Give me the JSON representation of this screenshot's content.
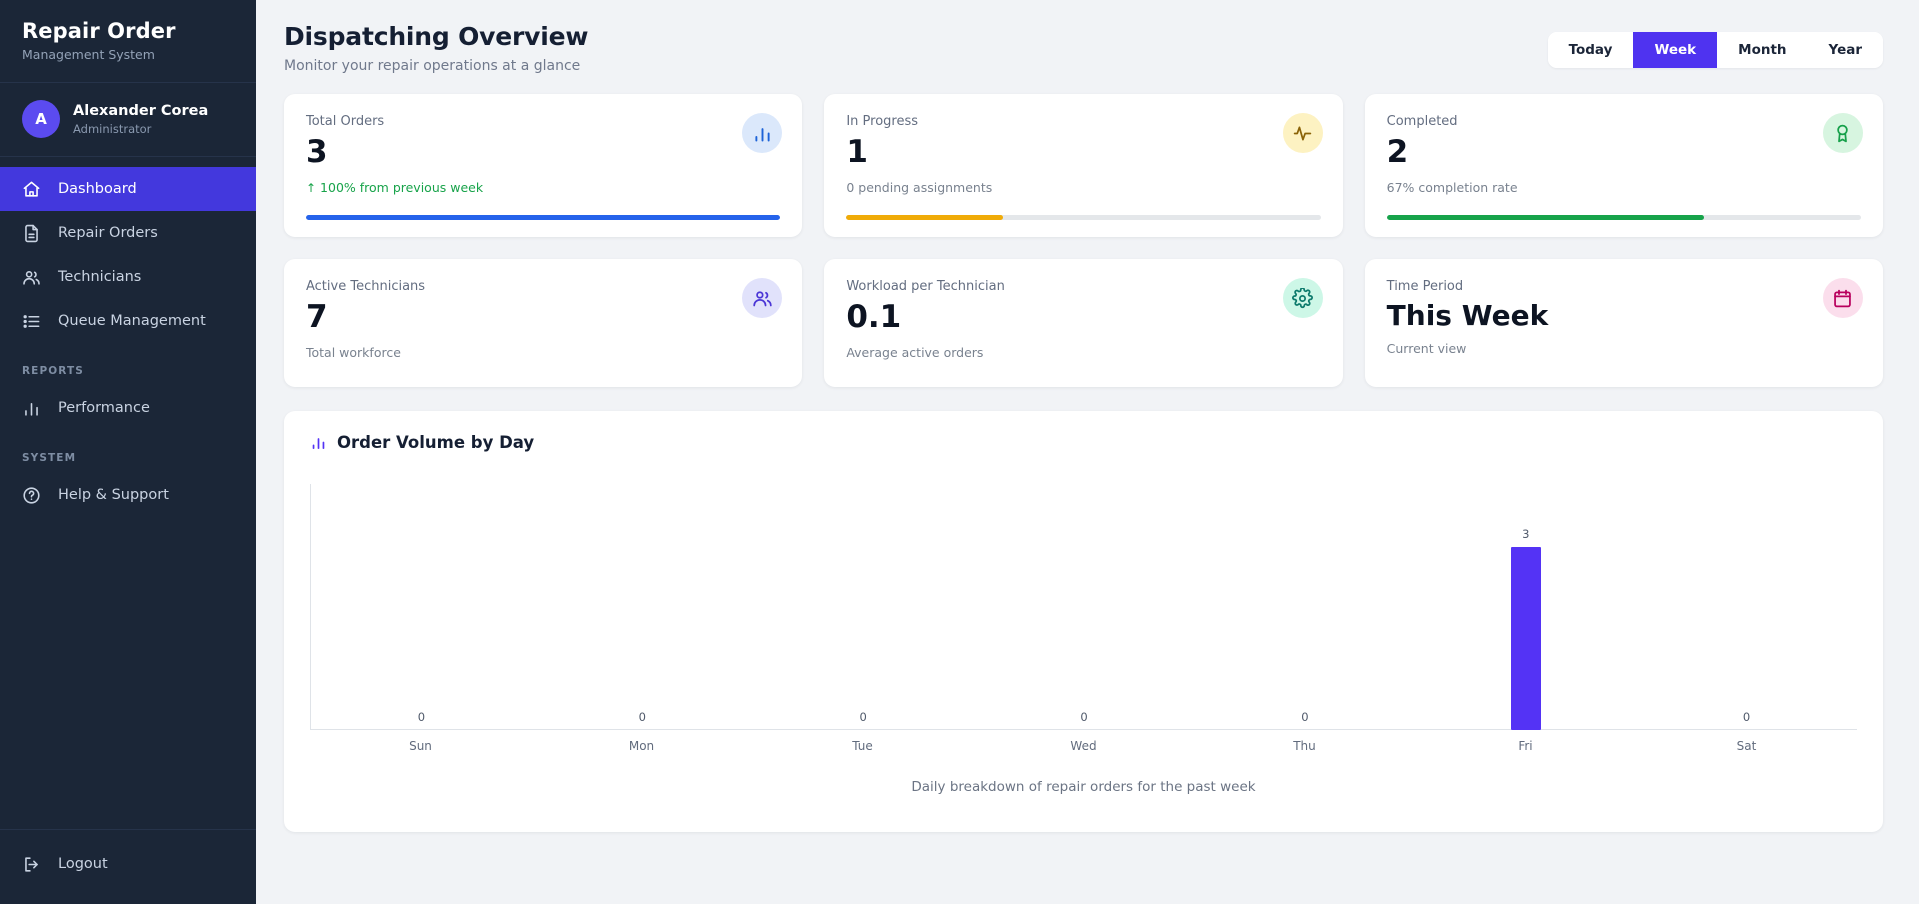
{
  "sidebar": {
    "brand_title": "Repair Order",
    "brand_subtitle": "Management System",
    "user": {
      "initial": "A",
      "name": "Alexander Corea",
      "role": "Administrator"
    },
    "items": [
      {
        "label": "Dashboard",
        "icon": "home-icon",
        "active": true
      },
      {
        "label": "Repair Orders",
        "icon": "document-icon",
        "active": false
      },
      {
        "label": "Technicians",
        "icon": "users-icon",
        "active": false
      },
      {
        "label": "Queue Management",
        "icon": "list-icon",
        "active": false
      }
    ],
    "reports_section": "REPORTS",
    "reports_items": [
      {
        "label": "Performance",
        "icon": "bar-chart-icon",
        "active": false
      }
    ],
    "system_section": "SYSTEM",
    "system_items": [
      {
        "label": "Help & Support",
        "icon": "help-circle-icon",
        "active": false
      }
    ],
    "logout_label": "Logout",
    "logout_icon": "logout-icon",
    "active_color": "#4338dd",
    "background_color": "#1b2637"
  },
  "header": {
    "title": "Dispatching Overview",
    "subtitle": "Monitor your repair operations at a glance",
    "range_options": [
      {
        "label": "Today",
        "active": false
      },
      {
        "label": "Week",
        "active": true
      },
      {
        "label": "Month",
        "active": false
      },
      {
        "label": "Year",
        "active": false
      }
    ],
    "active_color": "#4f33f0"
  },
  "cards": [
    {
      "label": "Total Orders",
      "value": "3",
      "note": "100% from previous week",
      "note_arrow": "↑",
      "note_trend": "up",
      "icon": "bar-chart-icon",
      "icon_color": "#1d63d8",
      "icon_bg": "#dbe8fb",
      "progress_percent": 100,
      "progress_color": "#2563eb"
    },
    {
      "label": "In Progress",
      "value": "1",
      "note": "0 pending assignments",
      "icon": "activity-icon",
      "icon_color": "#8a6206",
      "icon_bg": "#fdf2c2",
      "progress_percent": 33,
      "progress_color": "#f0ab07"
    },
    {
      "label": "Completed",
      "value": "2",
      "note": "67% completion rate",
      "icon": "award-icon",
      "icon_color": "#16a04a",
      "icon_bg": "#d7f5e0",
      "progress_percent": 67,
      "progress_color": "#16a34a"
    },
    {
      "label": "Active Technicians",
      "value": "7",
      "note": "Total workforce",
      "icon": "users-icon",
      "icon_color": "#4b36d6",
      "icon_bg": "#e1e2fb",
      "progress_percent": null
    },
    {
      "label": "Workload per Technician",
      "value": "0.1",
      "note": "Average active orders",
      "icon": "gear-icon",
      "icon_color": "#0d7a6c",
      "icon_bg": "#cdf7e7",
      "progress_percent": null
    },
    {
      "label": "Time Period",
      "value": "This Week",
      "note": "Current view",
      "icon": "calendar-icon",
      "icon_color": "#b8005d",
      "icon_bg": "#fbdeec",
      "progress_percent": null
    }
  ],
  "chart_panel": {
    "title": "Order Volume by Day",
    "title_icon": "bar-chart-icon",
    "footer": "Daily breakdown of repair orders for the past week"
  },
  "chart_data": {
    "type": "bar",
    "title": "Order Volume by Day",
    "xlabel": "",
    "ylabel": "",
    "categories": [
      "Sun",
      "Mon",
      "Tue",
      "Wed",
      "Thu",
      "Fri",
      "Sat"
    ],
    "values": [
      0,
      0,
      0,
      0,
      0,
      3,
      0
    ],
    "value_labels": [
      "0",
      "0",
      "0",
      "0",
      "0",
      "3",
      "0"
    ],
    "ylim": [
      0,
      3.4
    ],
    "grid": false,
    "legend": null,
    "bar_color": "#5433f5"
  }
}
